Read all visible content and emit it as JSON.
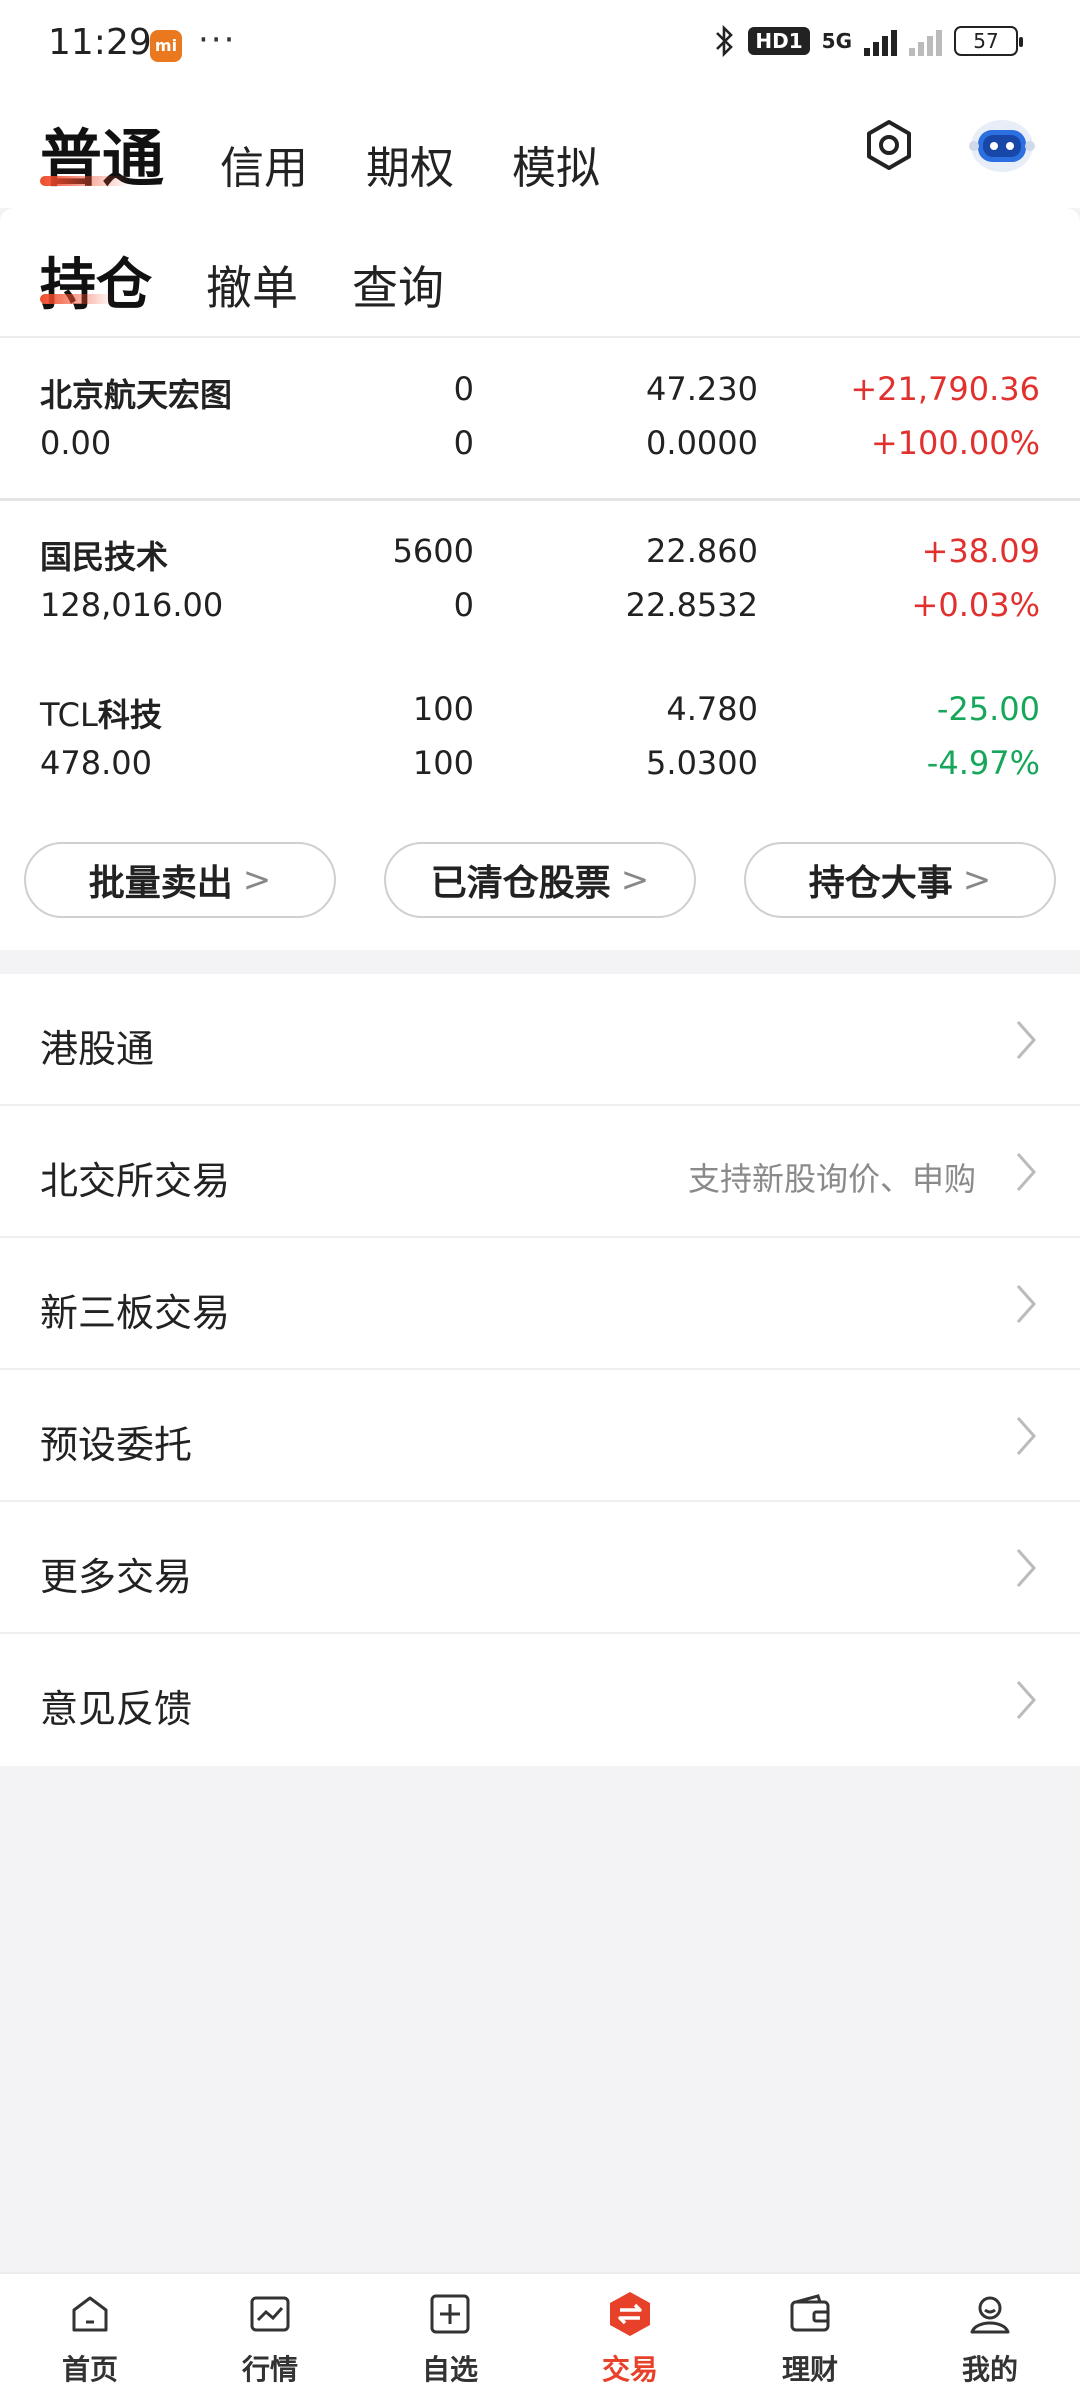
{
  "status_bar": {
    "time": "11:29",
    "app_icon": "mi",
    "more": "···",
    "network": "5G",
    "hd": "HD1",
    "battery": "57"
  },
  "top_tabs": [
    "普通",
    "信用",
    "期权",
    "模拟"
  ],
  "sub_tabs": [
    "持仓",
    "撤单",
    "查询"
  ],
  "holdings": [
    {
      "name": "北京航天宏图",
      "value": "0.00",
      "qty1": "0",
      "qty2": "0",
      "price": "47.230",
      "cost": "0.0000",
      "pl": "+21,790.36",
      "pl_pct": "+100.00%",
      "color": "#e0312f"
    },
    {
      "name": "国民技术",
      "value": "128,016.00",
      "qty1": "5600",
      "qty2": "0",
      "price": "22.860",
      "cost": "22.8532",
      "pl": "+38.09",
      "pl_pct": "+0.03%",
      "color": "#e0312f"
    },
    {
      "name": "TCL科技",
      "value": "478.00",
      "qty1": "100",
      "qty2": "100",
      "price": "4.780",
      "cost": "5.0300",
      "pl": "-25.00",
      "pl_pct": "-4.97%",
      "color": "#16a75a"
    }
  ],
  "actions": {
    "batch_sell": "批量卖出",
    "cleared_stocks": "已清仓股票",
    "holding_events": "持仓大事"
  },
  "menu": [
    {
      "label": "港股通",
      "hint": ""
    },
    {
      "label": "北交所交易",
      "hint": "支持新股询价、申购"
    },
    {
      "label": "新三板交易",
      "hint": ""
    },
    {
      "label": "预设委托",
      "hint": ""
    },
    {
      "label": "更多交易",
      "hint": ""
    },
    {
      "label": "意见反馈",
      "hint": ""
    }
  ],
  "bottom_nav": [
    {
      "label": "首页",
      "icon": "home-icon"
    },
    {
      "label": "行情",
      "icon": "chart-icon"
    },
    {
      "label": "自选",
      "icon": "add-box-icon"
    },
    {
      "label": "交易",
      "icon": "trade-icon"
    },
    {
      "label": "理财",
      "icon": "wallet-icon"
    },
    {
      "label": "我的",
      "icon": "profile-icon"
    }
  ],
  "colors": {
    "accent": "#e8412a",
    "up": "#e0312f",
    "down": "#16a75a"
  }
}
